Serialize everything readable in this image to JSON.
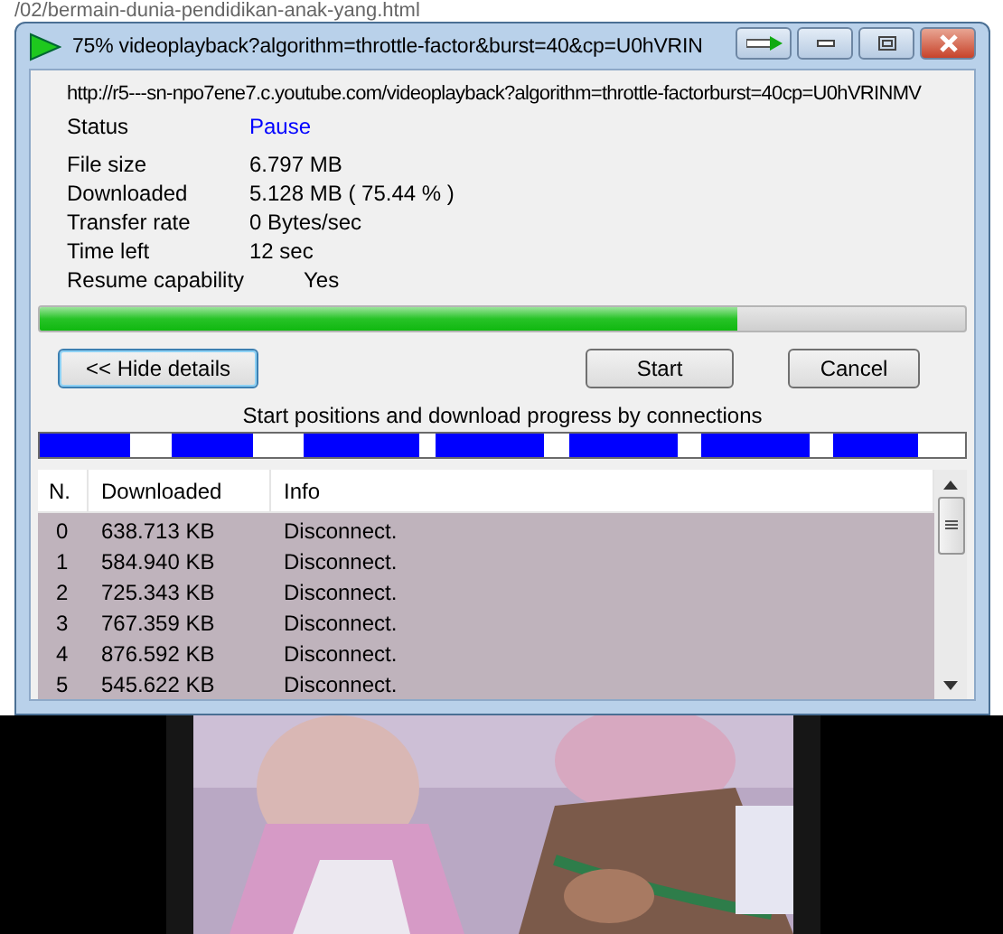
{
  "background_page": {
    "address_fragment": "/02/bermain-dunia-pendidikan-anak-yang.html"
  },
  "window": {
    "title": "75% videoplayback?algorithm=throttle-factor&burst=40&cp=U0hVRIN"
  },
  "url": "http://r5---sn-npo7ene7.c.youtube.com/videoplayback?algorithm=throttle-factorburst=40cp=U0hVRINMV",
  "status": {
    "label": "Status",
    "value": "Pause"
  },
  "details": [
    {
      "label": "File size",
      "value": "6.797  MB"
    },
    {
      "label": "Downloaded",
      "value": "5.128  MB  ( 75.44 % )"
    },
    {
      "label": "Transfer rate",
      "value": "0  Bytes/sec"
    },
    {
      "label": "Time left",
      "value": "12 sec"
    },
    {
      "label": "Resume capability",
      "value": "Yes",
      "kind": "indented"
    }
  ],
  "progress": {
    "level": 0.7544
  },
  "buttons": {
    "details": "<< Hide details",
    "start": "Start",
    "cancel": "Cancel"
  },
  "connections_label": "Start positions and download progress by connections",
  "connection_segments": [
    {
      "level": 0.7
    },
    {
      "level": 0.62
    },
    {
      "level": 0.89
    },
    {
      "level": 0.83
    },
    {
      "level": 0.84
    },
    {
      "level": 0.84
    },
    {
      "level": 0.65
    }
  ],
  "table": {
    "columns": [
      "N.",
      "Downloaded",
      "Info"
    ],
    "rows": [
      [
        "0",
        "638.713  KB",
        "Disconnect."
      ],
      [
        "1",
        "584.940  KB",
        "Disconnect."
      ],
      [
        "2",
        "725.343  KB",
        "Disconnect."
      ],
      [
        "3",
        "767.359  KB",
        "Disconnect."
      ],
      [
        "4",
        "876.592  KB",
        "Disconnect."
      ],
      [
        "5",
        "545.622  KB",
        "Disconnect."
      ]
    ]
  }
}
